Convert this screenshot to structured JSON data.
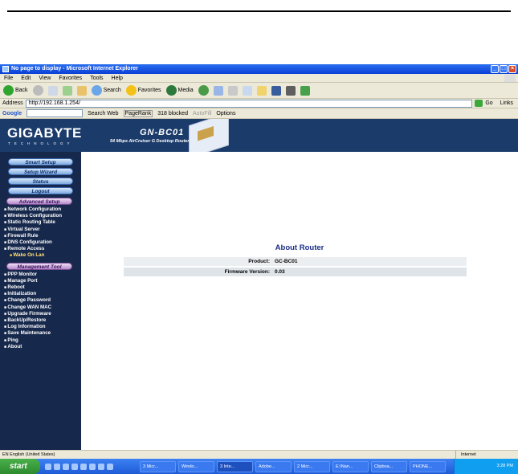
{
  "window": {
    "title": "No page to display - Microsoft Internet Explorer"
  },
  "menu": [
    "File",
    "Edit",
    "View",
    "Favorites",
    "Tools",
    "Help"
  ],
  "toolbar": {
    "back": "Back",
    "search": "Search",
    "favorites": "Favorites",
    "media": "Media"
  },
  "address": {
    "label": "Address",
    "url": "http://192.168.1.254/",
    "go": "Go",
    "links": "Links"
  },
  "googlebar": {
    "logo": "Google",
    "search_web": "Search Web",
    "pagerank": "PageRank",
    "blocked": "318 blocked",
    "autofill": "AutoFill",
    "options": "Options"
  },
  "header": {
    "brand": "GIGABYTE",
    "brand_sub": "TECHNOLOGY",
    "model": "GN-BC01",
    "model_sub": "54 Mbps AirCruiser G Desktop Router"
  },
  "sidebar": {
    "top_buttons": [
      "Smart Setup",
      "Setup Wizard",
      "Status",
      "Logout"
    ],
    "advanced_title": "Advanced Setup",
    "advanced_items": [
      "Network Configuration",
      "Wireless Configuration",
      "Static Routing Table",
      "Virtual Server",
      "Firewall Rule",
      "DNS Configuration",
      "Remote Access"
    ],
    "advanced_sub": "Wake On Lan",
    "management_title": "Management Tool",
    "management_items": [
      "PPP Monitor",
      "Manage Port",
      "Reboot",
      "Initialization",
      "Change Password",
      "Change WAN MAC",
      "Upgrade Firmware",
      "BackUp/Restore",
      "Log Information",
      "Save Maintenance",
      "Ping",
      "About"
    ]
  },
  "about": {
    "title": "About Router",
    "product_label": "Product:",
    "product_value": "GC-BC01",
    "firmware_label": "Firmware Version:",
    "firmware_value": "0.03"
  },
  "status": {
    "lang": "EN English (United States)",
    "zone": "Internet"
  },
  "taskbar": {
    "start": "start",
    "tasks": [
      "3 Micr...",
      "Windo...",
      "3 Inte...",
      "Adobe...",
      "2 Micr...",
      "E:\\Nan...",
      "Clipboa...",
      "PHONE..."
    ],
    "clock": "3:28 PM"
  }
}
